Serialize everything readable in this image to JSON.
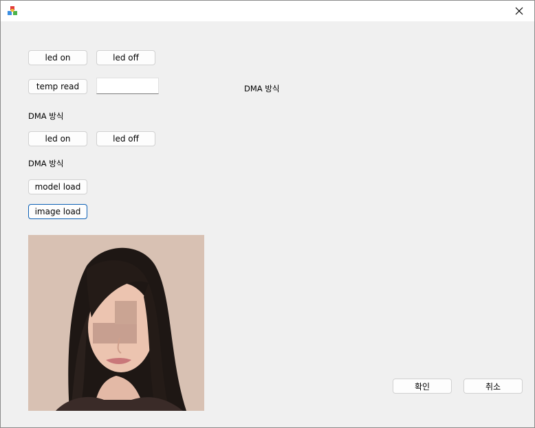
{
  "window": {
    "app_icon": "cube-stack-icon",
    "close_icon": "close-icon"
  },
  "buttons": {
    "led_on_1": "led on",
    "led_off_1": "led off",
    "temp_read": "temp read",
    "led_on_2": "led on",
    "led_off_2": "led off",
    "model_load": "model load",
    "image_load": "image load",
    "ok": "확인",
    "cancel": "취소"
  },
  "labels": {
    "dma_top_right": "DMA 방식",
    "dma_1": "DMA 방식",
    "dma_2": "DMA 방식"
  },
  "temp_input": {
    "value": ""
  },
  "image": {
    "subject": "portrait-photo"
  }
}
